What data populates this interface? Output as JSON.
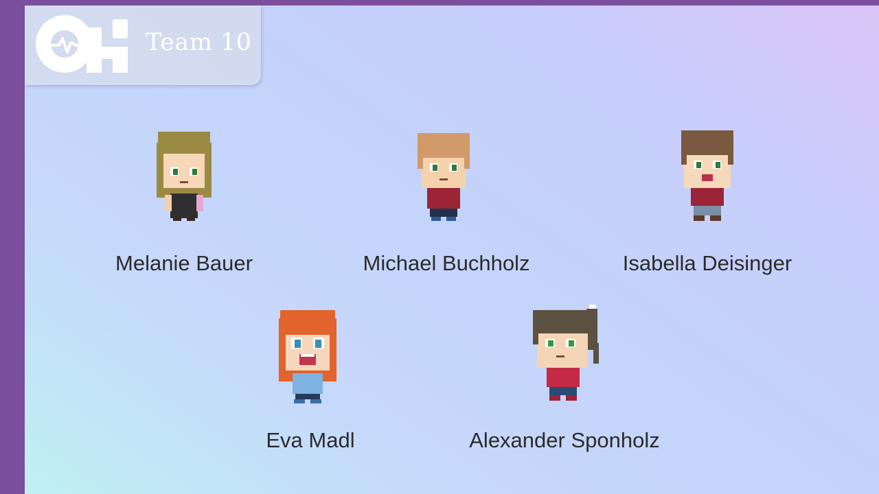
{
  "slide": {
    "title": "Team 10",
    "logo_icon": "heartbeat-logo-icon"
  },
  "colors": {
    "frame": "#7b4f9e",
    "title_text": "#ffffff",
    "name_text": "#2b2b2b"
  },
  "members": [
    {
      "name": "Melanie Bauer",
      "avatar_icon": "pixel-avatar-icon",
      "hair": "#9b8a43",
      "outfit": "#2f2f2f"
    },
    {
      "name": "Michael Buchholz",
      "avatar_icon": "pixel-avatar-icon",
      "hair": "#d19a68",
      "outfit": "#9b2437"
    },
    {
      "name": "Isabella Deisinger",
      "avatar_icon": "pixel-avatar-icon",
      "hair": "#7b5840",
      "outfit": "#9b2437"
    },
    {
      "name": "Eva Madl",
      "avatar_icon": "pixel-avatar-icon",
      "hair": "#e2632c",
      "outfit": "#7eb2e0"
    },
    {
      "name": "Alexander Sponholz",
      "avatar_icon": "pixel-avatar-icon",
      "hair": "#5c5040",
      "outfit": "#c42a44"
    }
  ]
}
